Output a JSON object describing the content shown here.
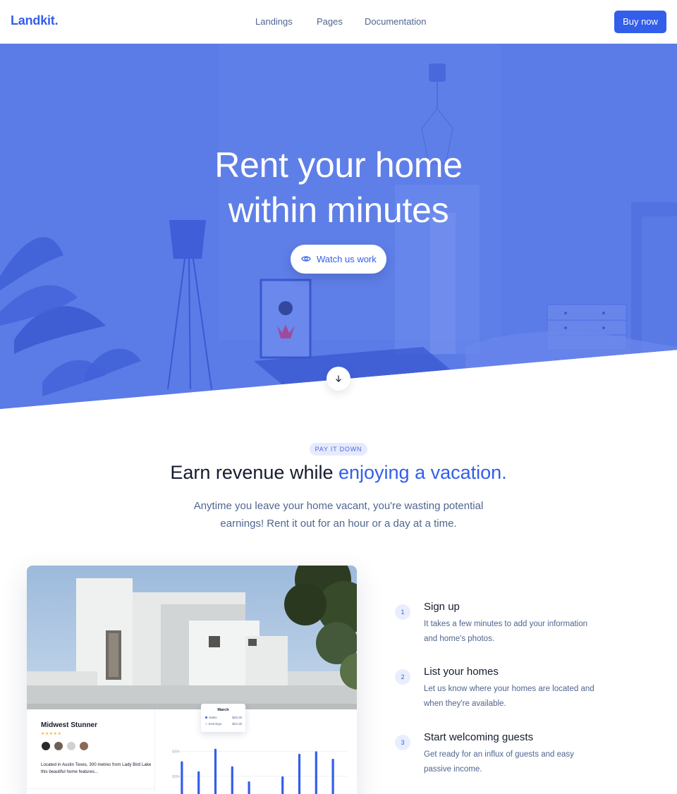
{
  "nav": {
    "brand": "Landkit.",
    "links": [
      "Landings",
      "Pages",
      "Documentation"
    ],
    "cta": "Buy now"
  },
  "hero": {
    "title_line1": "Rent your home",
    "title_line2": "within minutes",
    "watch_label": "Watch us work",
    "overlay_color": "#335eea"
  },
  "section": {
    "badge": "PAY IT DOWN",
    "title_plain": "Earn revenue while ",
    "title_accent": "enjoying a vacation.",
    "lead": "Anytime you leave your home vacant, you're wasting potential earnings! Rent it out for an hour or a day at a time."
  },
  "card": {
    "listing_title": "Midwest Stunner",
    "stars": "★★★★★",
    "description": "Located in Austin Texes, 300 metres from Lady Bird Lake this beautiful home features...",
    "tooltip": {
      "month": "March",
      "rows": [
        {
          "label": "Sales",
          "value": "$29.3k"
        },
        {
          "label": "Earnings",
          "value": "$22.3k"
        }
      ]
    }
  },
  "chart_data": {
    "type": "bar",
    "y_ticks": [
      "$30k",
      "$20k",
      "$10k"
    ],
    "series": [
      {
        "values": [
          26,
          22,
          31,
          24,
          18,
          10,
          20,
          29,
          30,
          27
        ]
      }
    ],
    "ylim": [
      0,
      36
    ],
    "color": "#335eea"
  },
  "steps": [
    {
      "num": "1",
      "title": "Sign up",
      "desc": "It takes a few minutes to add your information and home's photos."
    },
    {
      "num": "2",
      "title": "List your homes",
      "desc": "Let us know where your homes are located and when they're available."
    },
    {
      "num": "3",
      "title": "Start welcoming guests",
      "desc": "Get ready for an influx of guests and easy passive income."
    }
  ],
  "colors": {
    "primary": "#335eea",
    "text": "#161c2d",
    "muted": "#506690"
  }
}
